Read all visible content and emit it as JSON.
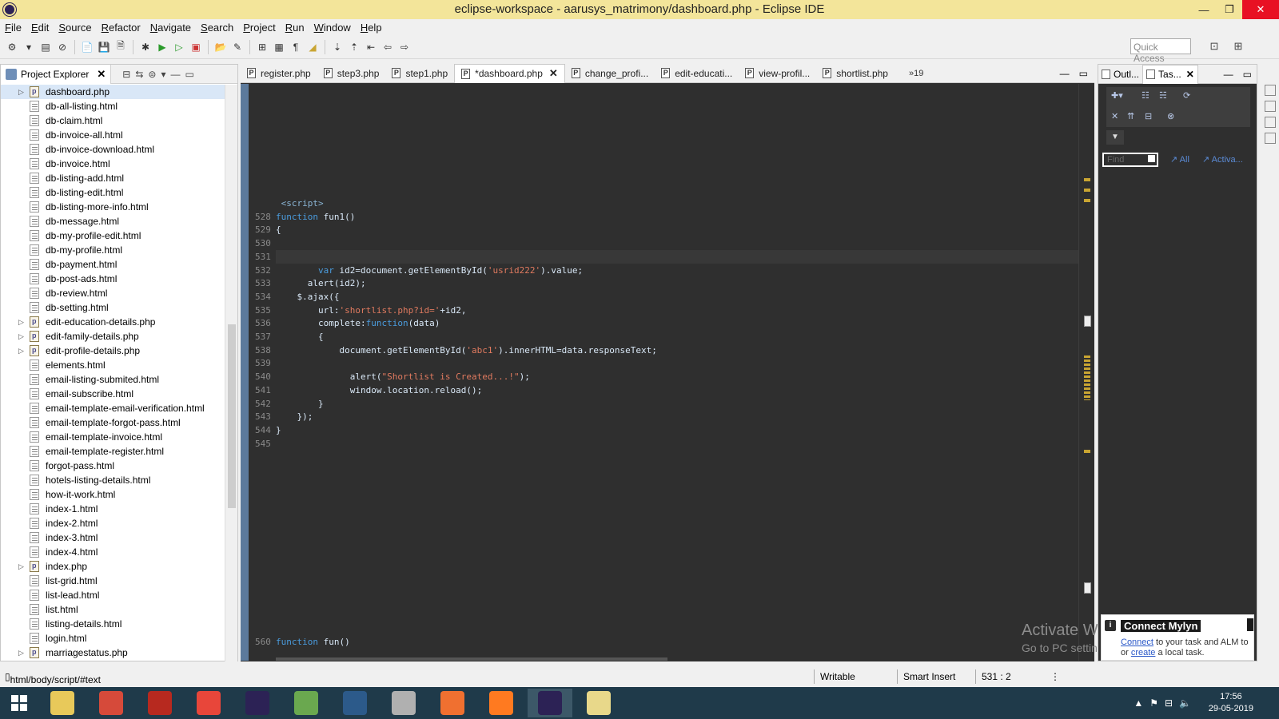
{
  "window": {
    "title": "eclipse-workspace - aarusys_matrimony/dashboard.php - Eclipse IDE",
    "minimize": "—",
    "restore": "❐",
    "close": "✕"
  },
  "menu": [
    "File",
    "Edit",
    "Source",
    "Refactor",
    "Navigate",
    "Search",
    "Project",
    "Run",
    "Window",
    "Help"
  ],
  "quick_access": "Quick Access",
  "project_explorer": {
    "title": "Project Explorer",
    "files": [
      {
        "name": "dashboard.php",
        "type": "php",
        "expandable": true,
        "selected": true
      },
      {
        "name": "db-all-listing.html",
        "type": "html"
      },
      {
        "name": "db-claim.html",
        "type": "html"
      },
      {
        "name": "db-invoice-all.html",
        "type": "html"
      },
      {
        "name": "db-invoice-download.html",
        "type": "html"
      },
      {
        "name": "db-invoice.html",
        "type": "html"
      },
      {
        "name": "db-listing-add.html",
        "type": "html"
      },
      {
        "name": "db-listing-edit.html",
        "type": "html"
      },
      {
        "name": "db-listing-more-info.html",
        "type": "html"
      },
      {
        "name": "db-message.html",
        "type": "html"
      },
      {
        "name": "db-my-profile-edit.html",
        "type": "html"
      },
      {
        "name": "db-my-profile.html",
        "type": "html"
      },
      {
        "name": "db-payment.html",
        "type": "html"
      },
      {
        "name": "db-post-ads.html",
        "type": "html"
      },
      {
        "name": "db-review.html",
        "type": "html"
      },
      {
        "name": "db-setting.html",
        "type": "html"
      },
      {
        "name": "edit-education-details.php",
        "type": "php",
        "expandable": true
      },
      {
        "name": "edit-family-details.php",
        "type": "php",
        "expandable": true
      },
      {
        "name": "edit-profile-details.php",
        "type": "php",
        "expandable": true
      },
      {
        "name": "elements.html",
        "type": "html"
      },
      {
        "name": "email-listing-submited.html",
        "type": "html"
      },
      {
        "name": "email-subscribe.html",
        "type": "html"
      },
      {
        "name": "email-template-email-verification.html",
        "type": "html"
      },
      {
        "name": "email-template-forgot-pass.html",
        "type": "html"
      },
      {
        "name": "email-template-invoice.html",
        "type": "html"
      },
      {
        "name": "email-template-register.html",
        "type": "html"
      },
      {
        "name": "forgot-pass.html",
        "type": "html"
      },
      {
        "name": "hotels-listing-details.html",
        "type": "html"
      },
      {
        "name": "how-it-work.html",
        "type": "html"
      },
      {
        "name": "index-1.html",
        "type": "html"
      },
      {
        "name": "index-2.html",
        "type": "html"
      },
      {
        "name": "index-3.html",
        "type": "html"
      },
      {
        "name": "index-4.html",
        "type": "html"
      },
      {
        "name": "index.php",
        "type": "php",
        "expandable": true
      },
      {
        "name": "list-grid.html",
        "type": "html"
      },
      {
        "name": "list-lead.html",
        "type": "html"
      },
      {
        "name": "list.html",
        "type": "html"
      },
      {
        "name": "listing-details.html",
        "type": "html"
      },
      {
        "name": "login.html",
        "type": "html"
      },
      {
        "name": "marriagestatus.php",
        "type": "php",
        "expandable": true
      }
    ]
  },
  "editor": {
    "tabs": [
      {
        "label": "register.php"
      },
      {
        "label": "step3.php"
      },
      {
        "label": "step1.php"
      },
      {
        "label": "*dashboard.php",
        "active": true
      },
      {
        "label": "change_profi..."
      },
      {
        "label": "edit-educati..."
      },
      {
        "label": "view-profil..."
      },
      {
        "label": "shortlist.php"
      }
    ],
    "more_tabs": "»19",
    "lines": [
      {
        "n": "",
        "html": "<span class=\"tag\">&lt;script&gt;</span>",
        "indent": " "
      },
      {
        "n": "528",
        "html": "<span class=\"kw\">function</span> fun1()"
      },
      {
        "n": "529",
        "html": "{"
      },
      {
        "n": "530",
        "html": ""
      },
      {
        "n": "531",
        "html": "",
        "current": true
      },
      {
        "n": "532",
        "html": "        <span class=\"kw\">var</span> id2=document.getElementById(<span class=\"str\">'usrid222'</span>).value;"
      },
      {
        "n": "533",
        "html": "      alert(id2);"
      },
      {
        "n": "534",
        "html": "    $.ajax({"
      },
      {
        "n": "535",
        "html": "        url:<span class=\"str\">'shortlist.php?id='</span>+id2,"
      },
      {
        "n": "536",
        "html": "        complete:<span class=\"kw\">function</span>(data)"
      },
      {
        "n": "537",
        "html": "        {"
      },
      {
        "n": "538",
        "html": "            document.getElementById(<span class=\"str\">'abc1'</span>).innerHTML=data.responseText;"
      },
      {
        "n": "539",
        "html": ""
      },
      {
        "n": "540",
        "html": "              alert(<span class=\"str\">\"Shortlist is Created...!\"</span>);"
      },
      {
        "n": "541",
        "html": "              window.location.reload();"
      },
      {
        "n": "542",
        "html": "        }"
      },
      {
        "n": "543",
        "html": "    });"
      },
      {
        "n": "544",
        "html": "}"
      },
      {
        "n": "545",
        "html": ""
      }
    ],
    "bottom_line_number": "560",
    "bottom_line_html": "<span class=\"kw\">function</span> fun()"
  },
  "outline_tasks": {
    "tab_outline": "Outl...",
    "tab_tasks": "Tas...",
    "find_placeholder": "Find",
    "link_all": "All",
    "link_activate": "Activa...",
    "mylyn_title": "Connect Mylyn",
    "mylyn_connect": "Connect",
    "mylyn_body1": " to your task and ALM to",
    "mylyn_or": "or ",
    "mylyn_create": "create",
    "mylyn_body2": " a local task."
  },
  "watermark": {
    "line1": "Activate Windows",
    "line2": "Go to PC settings to activate Windows."
  },
  "statusbar": {
    "path": "html/body/script/#text",
    "writable": "Writable",
    "insert_mode": "Smart Insert",
    "position": "531 : 2"
  },
  "taskbar": {
    "time": "17:56",
    "date": "29-05-2019",
    "apps": [
      {
        "name": "file-explorer",
        "color": "#e8c95a"
      },
      {
        "name": "chrome",
        "color": "#d64a3a"
      },
      {
        "name": "filezilla",
        "color": "#b7291f"
      },
      {
        "name": "git",
        "color": "#e8463a"
      },
      {
        "name": "eclipse",
        "color": "#2c2255"
      },
      {
        "name": "notepad",
        "color": "#6aa84f"
      },
      {
        "name": "mysql-workbench",
        "color": "#2c5a8a"
      },
      {
        "name": "tools",
        "color": "#b0b0b0"
      },
      {
        "name": "xampp",
        "color": "#f07030"
      },
      {
        "name": "firefox",
        "color": "#ff7a20"
      },
      {
        "name": "eclipse-active",
        "color": "#2c2255",
        "active": true
      },
      {
        "name": "folder",
        "color": "#e8d88a"
      }
    ]
  }
}
